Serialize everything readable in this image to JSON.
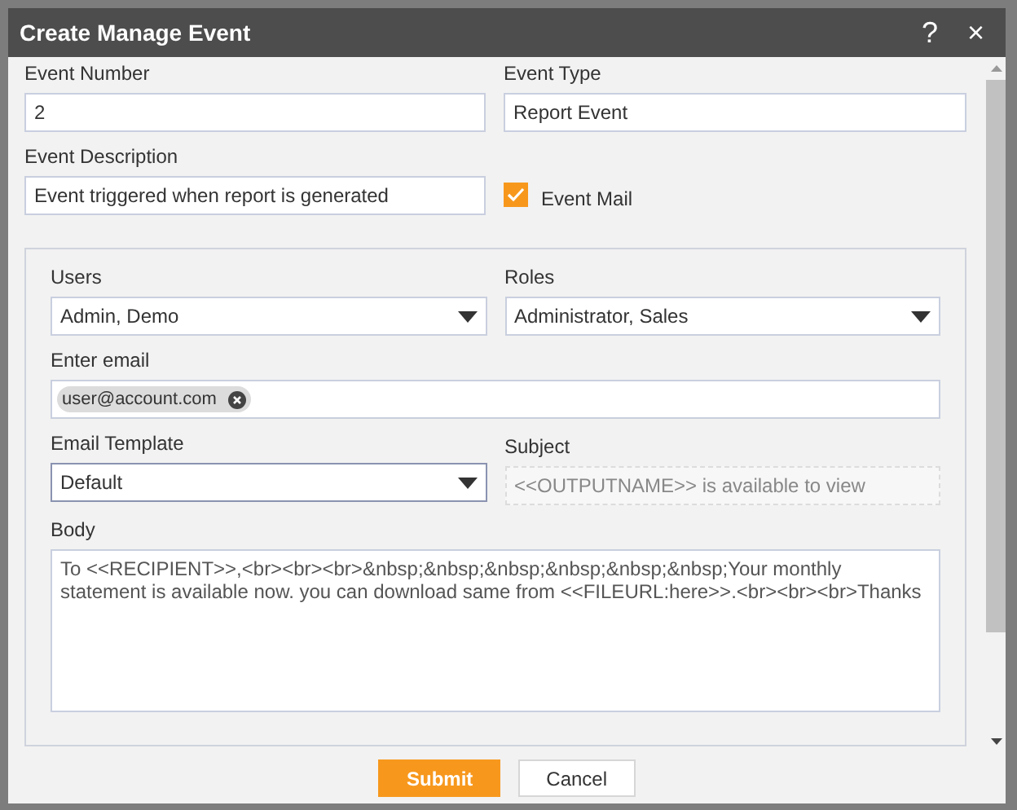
{
  "dialog": {
    "title": "Create Manage Event",
    "help": "?",
    "close": "×"
  },
  "event_number": {
    "label": "Event Number",
    "value": "2"
  },
  "event_type": {
    "label": "Event Type",
    "value": "Report Event"
  },
  "event_description": {
    "label": "Event Description",
    "value": "Event triggered when report is generated"
  },
  "event_mail": {
    "label": "Event Mail",
    "checked": true
  },
  "users": {
    "label": "Users",
    "value": "Admin, Demo"
  },
  "roles": {
    "label": "Roles",
    "value": "Administrator, Sales"
  },
  "email": {
    "label": "Enter email",
    "chips": [
      "user@account.com"
    ]
  },
  "email_template": {
    "label": "Email Template",
    "value": "Default"
  },
  "subject": {
    "label": "Subject",
    "placeholder": "<<OUTPUTNAME>> is available to view"
  },
  "body": {
    "label": "Body",
    "value": "To <<RECIPIENT>>,<br><br><br>&nbsp;&nbsp;&nbsp;&nbsp;&nbsp;&nbsp;Your monthly statement is available now. you can download same from <<FILEURL:here>>.<br><br><br>Thanks"
  },
  "buttons": {
    "submit": "Submit",
    "cancel": "Cancel"
  }
}
